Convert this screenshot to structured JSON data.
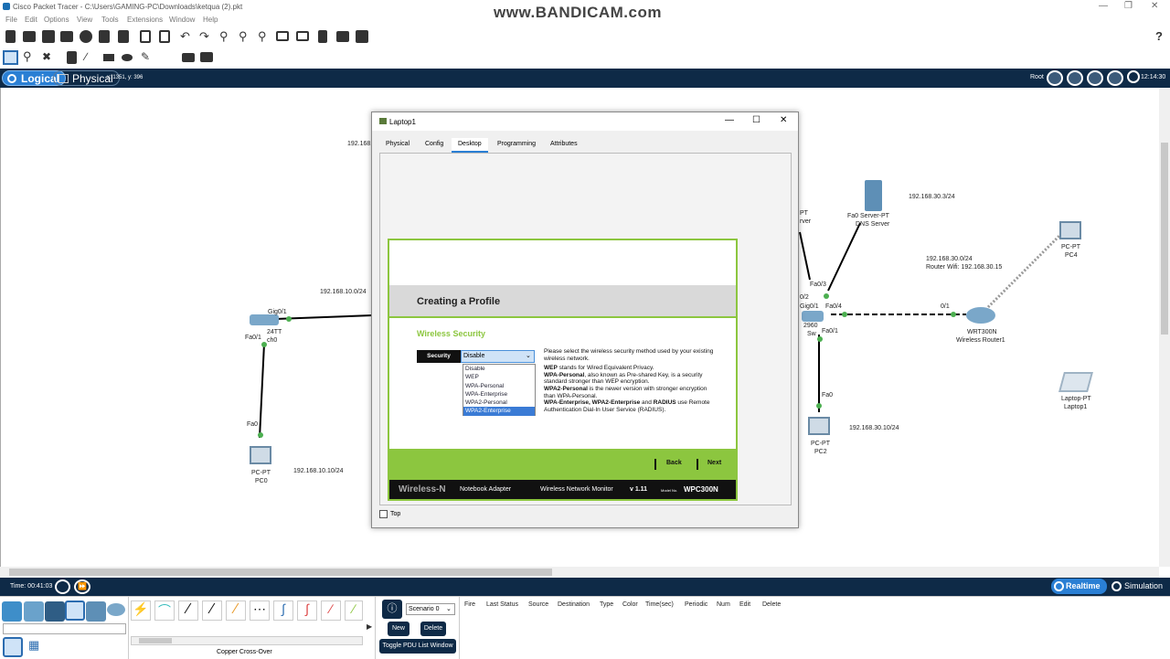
{
  "app": {
    "title": "Cisco Packet Tracer - C:\\Users\\GAMING-PC\\Downloads\\ketqua (2).pkt",
    "watermark": "www.BANDICAM.com"
  },
  "menu": [
    "File",
    "Edit",
    "Options",
    "View",
    "Tools",
    "Extensions",
    "Window",
    "Help"
  ],
  "toolbar": {
    "help": "?"
  },
  "modebar": {
    "logical": "Logical",
    "physical": "Physical",
    "coords": "x: 1351, y: 396",
    "root": "Root",
    "clock": "12:14:30"
  },
  "canvas": {
    "labels": {
      "net1": "192.168.",
      "net2": "192.168.10.0/24",
      "gig01": "Gig0/1",
      "sw24tt": "24TT",
      "sw0": "ch0",
      "fa01a": "Fa0/1",
      "fa0a": "Fa0",
      "pc0type": "PC-PT",
      "pc0name": "PC0",
      "pc0ip": "192.168.10.10/24",
      "srvpt": "PT",
      "srvname": "rver",
      "dnsport": "Fa0 Server-PT",
      "dnsname": "DNS Server",
      "dnsip": "192.168.30.3/24",
      "pc4type": "PC-PT",
      "pc4name": "PC4",
      "wifi1": "192.168.30.0/24",
      "wifi2": "Router Wifi: 192.168.30.15",
      "fa03": "Fa0/3",
      "gig02": "0/2",
      "gig01b": "Gig0/1",
      "fa04": "Fa0/4",
      "sw2960": "2960",
      "swname": "Sw",
      "fa01b": "Fa0/1",
      "port01": "0/1",
      "rtrtype": "WRT300N",
      "rtrname": "Wireless Router1",
      "fa0b": "Fa0",
      "pc2type": "PC-PT",
      "pc2name": "PC2",
      "pc2ip": "192.168.30.10/24",
      "laptoptype": "Laptop-PT",
      "laptopname": "Laptop1"
    }
  },
  "dialog": {
    "title": "Laptop1",
    "tabs": [
      "Physical",
      "Config",
      "Desktop",
      "Programming",
      "Attributes"
    ],
    "active_tab": "Desktop",
    "top_checkbox": "Top",
    "wireless": {
      "heading": "Creating a Profile",
      "section": "Wireless Security",
      "security_label": "Security",
      "security_value": "Disable",
      "options": [
        "Disable",
        "WEP",
        "WPA-Personal",
        "WPA-Enterprise",
        "WPA2-Personal",
        "WPA2-Enterprise"
      ],
      "highlighted_option": "WPA2-Enterprise",
      "desc_intro": "Please select the wireless security method used by your existing wireless network.",
      "desc_wep_b": "WEP",
      "desc_wep": " stands for Wired Equivalent Privacy.",
      "desc_wpa_b": "WPA-Personal",
      "desc_wpa": ", also known as Pre-shared Key, is a security standard stronger than WEP encryption.",
      "desc_wpa2_b": "WPA2-Personal",
      "desc_wpa2": " is the newer version with stronger encryption than WPA-Personal.",
      "desc_ent_b": "WPA-Enterprise, WPA2-Enterprise",
      "desc_ent_mid": " and ",
      "desc_ent_b2": "RADIUS",
      "desc_ent": " use Remote Authentication Dial-In User Service (RADIUS).",
      "back": "Back",
      "next": "Next",
      "brand": "Wireless-N",
      "adapter": "Notebook Adapter",
      "monitor": "Wireless Network Monitor",
      "version": "v 1.11",
      "model_label": "Model No.",
      "model": "WPC300N"
    }
  },
  "status": {
    "time": "Time: 00:41:03",
    "realtime": "Realtime",
    "simulation": "Simulation"
  },
  "bottom": {
    "scenario": "Scenario 0",
    "new": "New",
    "delete": "Delete",
    "toggle": "Toggle PDU List Window",
    "cable": "Copper Cross-Over",
    "columns": [
      "Fire",
      "Last Status",
      "Source",
      "Destination",
      "Type",
      "Color",
      "Time(sec)",
      "Periodic",
      "Num",
      "Edit",
      "Delete"
    ]
  }
}
